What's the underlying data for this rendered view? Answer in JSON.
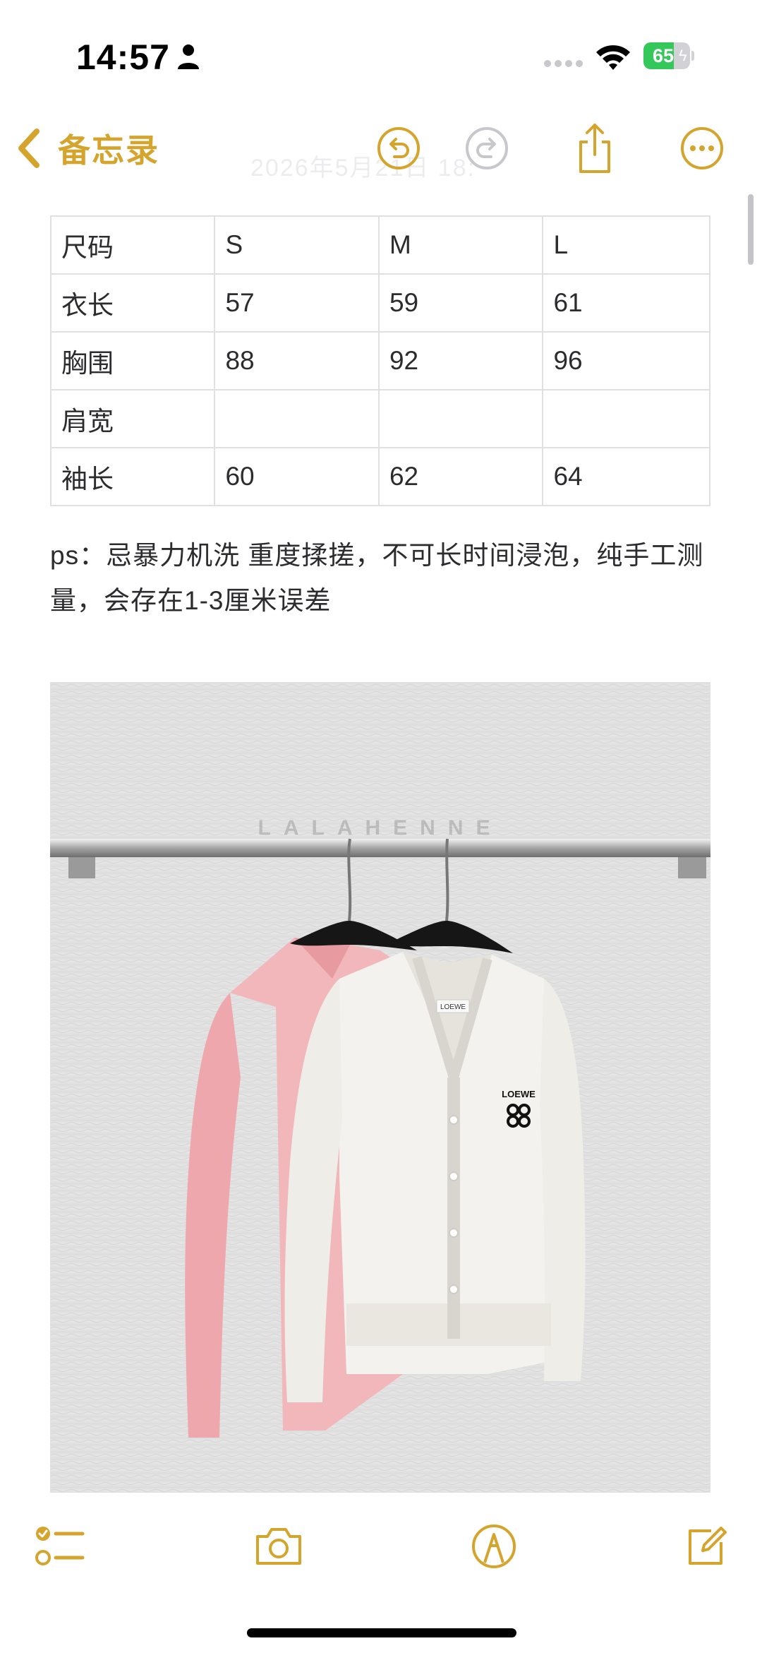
{
  "status_bar": {
    "time": "14:57",
    "battery_level": "65",
    "battery_fraction": 0.65,
    "icons": [
      "person-icon",
      "signal-icon",
      "wifi-icon",
      "battery-icon"
    ]
  },
  "nav": {
    "back_label": "备忘录",
    "ghost_title": "2026年5月21日 18:",
    "icons": [
      "chevron-left-icon",
      "undo-icon",
      "redo-icon",
      "share-icon",
      "more-icon"
    ],
    "accent_color": "#d4a42c"
  },
  "table": {
    "rows": [
      [
        "尺码",
        "S",
        "M",
        "L"
      ],
      [
        "衣长",
        "57",
        "59",
        "61"
      ],
      [
        "胸围",
        "88",
        "92",
        "96"
      ],
      [
        "肩宽",
        "",
        "",
        ""
      ],
      [
        "袖长",
        "60",
        "62",
        "64"
      ]
    ]
  },
  "note": {
    "text": "ps：忌暴力机洗 重度揉搓，不可长时间浸泡，纯手工测量，会存在1-3厘米误差"
  },
  "photo": {
    "watermark": "LALAHENNE",
    "logo_text": "LOEWE"
  },
  "toolbar": {
    "icons": [
      "checklist-icon",
      "camera-icon",
      "markup-icon",
      "compose-icon"
    ]
  }
}
